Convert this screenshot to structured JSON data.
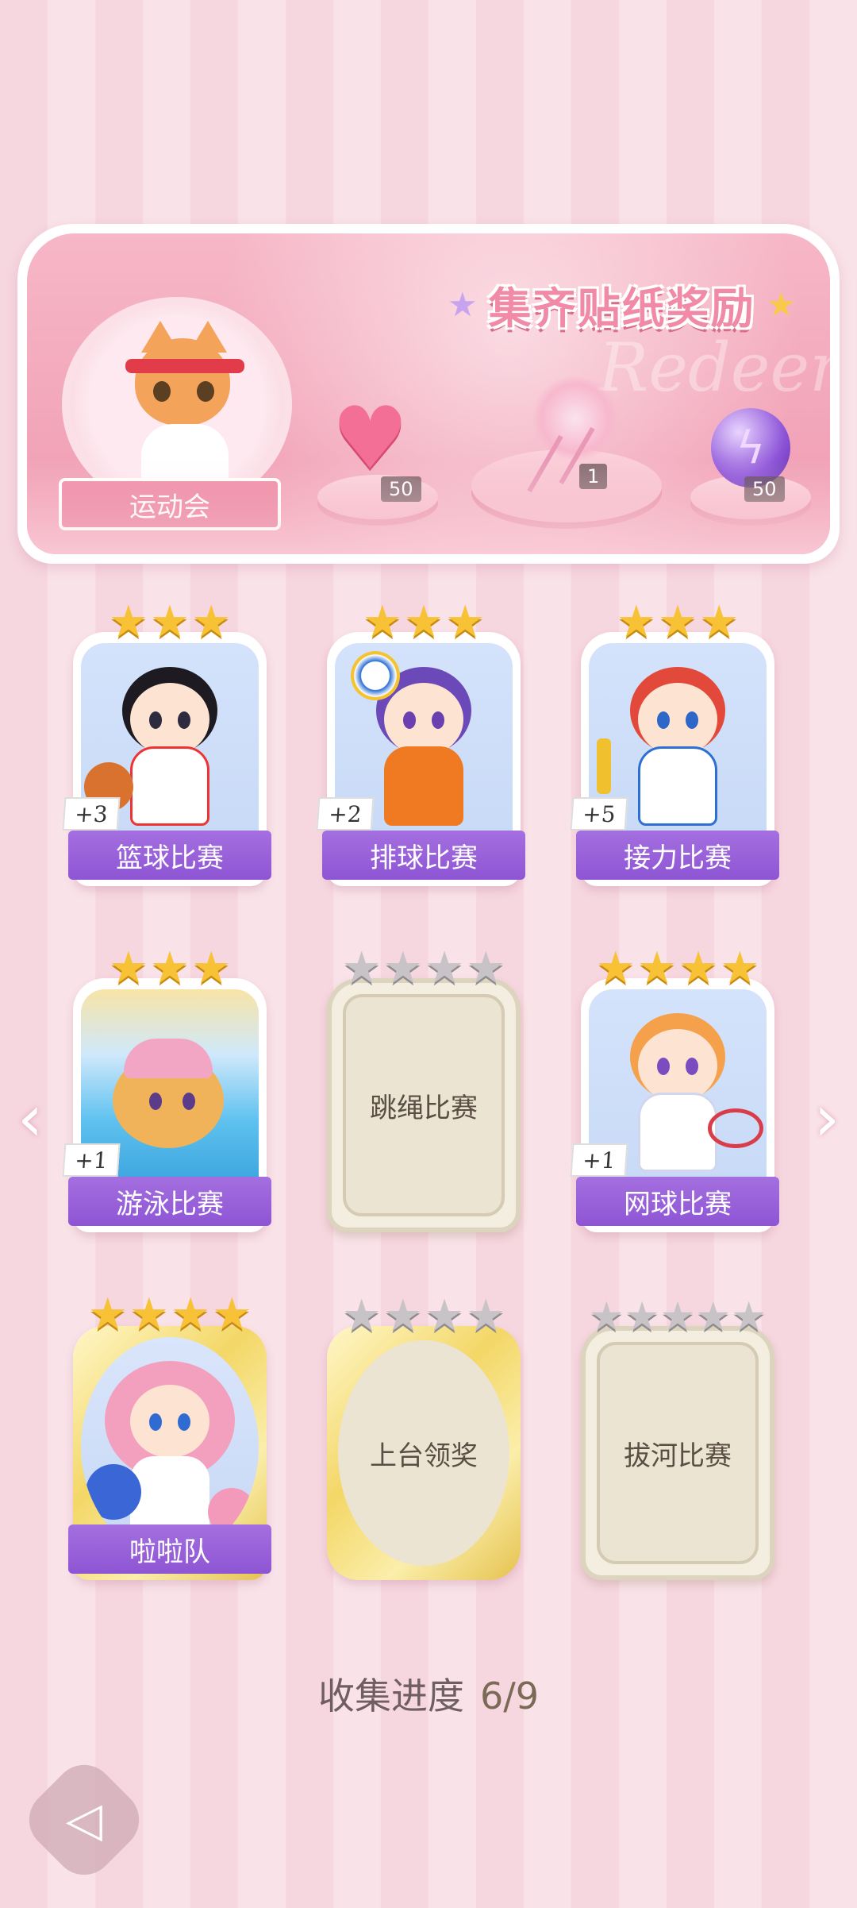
{
  "banner": {
    "title": "集齐贴纸奖励",
    "watermark": "Redeem",
    "event_label": "运动会",
    "rewards": [
      {
        "icon": "pink-heart-gem-icon",
        "count": "50"
      },
      {
        "icon": "flower-bouquet-icon",
        "count": "1"
      },
      {
        "icon": "purple-energy-orb-icon",
        "count": "50"
      }
    ]
  },
  "stickers": [
    {
      "name": "篮球比赛",
      "bonus": "+3",
      "stars": 3,
      "collected": true
    },
    {
      "name": "排球比赛",
      "bonus": "+2",
      "stars": 3,
      "collected": true
    },
    {
      "name": "接力比赛",
      "bonus": "+5",
      "stars": 3,
      "collected": true
    },
    {
      "name": "游泳比赛",
      "bonus": "+1",
      "stars": 3,
      "collected": true
    },
    {
      "name": "跳绳比赛",
      "bonus": "",
      "stars": 4,
      "collected": false
    },
    {
      "name": "网球比赛",
      "bonus": "+1",
      "stars": 4,
      "collected": true
    },
    {
      "name": "啦啦队",
      "bonus": "",
      "stars": 4,
      "collected": true
    },
    {
      "name": "上台领奖",
      "bonus": "",
      "stars": 4,
      "collected": false
    },
    {
      "name": "拔河比赛",
      "bonus": "",
      "stars": 5,
      "collected": false
    }
  ],
  "progress": {
    "label": "收集进度",
    "value": "6/9"
  },
  "nav": {
    "prev": "‹",
    "next": "›",
    "back": "◁"
  }
}
